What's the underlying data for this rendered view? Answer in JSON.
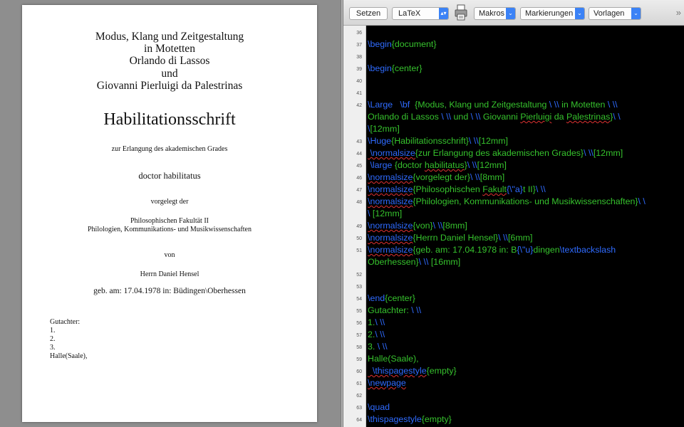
{
  "preview": {
    "header_lines": [
      "Modus, Klang und Zeitgestaltung",
      "in Motetten",
      "Orlando di Lassos",
      "und",
      "Giovanni Pierluigi da Palestrinas"
    ],
    "huge_title": "Habilitationsschrift",
    "erlangung": "zur Erlangung des akademischen Grades",
    "degree": "doctor habilitatus",
    "vorgelegt": "vorgelegt der",
    "faculty": "Philosophischen Fakultät II",
    "departments": "Philologien, Kommunikations- und Musikwissenschaften",
    "von": "von",
    "author": "Herrn Daniel Hensel",
    "born": "geb. am: 17.04.1978 in: Büdingen\\Oberhessen",
    "gutachter": "Gutachter:",
    "g1": "1.",
    "g2": "2.",
    "g3": "3.",
    "place": "Halle(Saale),"
  },
  "toolbar": {
    "setzen": "Setzen",
    "format": "LaTeX",
    "makros": "Makros",
    "markierungen": "Markierungen",
    "vorlagen": "Vorlagen",
    "arrow": "⌄",
    "more": "»",
    "icons": {
      "print": "printer-icon",
      "more": "chevron-double-right-icon"
    }
  },
  "editor": {
    "line_numbers": [
      "36",
      "37",
      "38",
      "39",
      "40",
      "41",
      "42",
      "43",
      "44",
      "45",
      "46",
      "47",
      "48",
      "49",
      "50",
      "51",
      "52",
      "53",
      "54",
      "55",
      "56",
      "57",
      "58",
      "59",
      "60",
      "61",
      "62",
      "63",
      "64"
    ],
    "code": {
      "l37a": "\\begin",
      "l37b": "{document}",
      "l39a": "\\begin",
      "l39b": "{center}",
      "l42a": "\\Large   \\bf",
      "l42b": "  {Modus, Klang und Zeitgestaltung ",
      "l42c": "\\ \\\\",
      "l42d": " in Motetten ",
      "l42e": "\\ \\\\",
      "l42f": "Orlando di Lassos ",
      "l42g": "\\ \\\\",
      "l42h": " und ",
      "l42i": "\\ \\\\",
      "l42j": " Giovanni ",
      "l42k": "Pierluigi",
      "l42l": " da ",
      "l42m": "Palestrinas",
      "l42n": "}",
      "l42o": "\\ \\",
      "l42p": "\\",
      "l42q": "[12mm]",
      "l43a": "\\Huge",
      "l43b": "{Habilitationsschrift}",
      "l43c": "\\ \\\\",
      "l43d": "[12mm]",
      "l44a": " \\normalsize",
      "l44b": "{zur Erlangung des akademischen Grades}",
      "l44c": "\\ \\\\",
      "l44d": "[12mm]",
      "l45a": " \\large",
      "l45b": " {doctor ",
      "l45c": "habilitatus",
      "l45d": "}",
      "l45e": "\\ \\\\",
      "l45f": "[12mm]",
      "l46a": "\\normalsize",
      "l46b": "{vorgelegt der}",
      "l46c": "\\ \\\\",
      "l46d": "[8mm]",
      "l47a": "\\normalsize",
      "l47b": "{Philosophischen ",
      "l47c": "Fakult",
      "l47d": "{\\\"a}",
      "l47e": "t II}",
      "l47f": "\\ \\\\",
      "l48a": "\\normalsize",
      "l48b": "{Philologien, Kommunikations- und Musikwissenschaften}",
      "l48c": "\\ \\",
      "l48d": "\\",
      "l48e": " [12mm]",
      "l49a": "\\normalsize",
      "l49b": "{von}",
      "l49c": "\\ \\\\",
      "l49d": "[8mm]",
      "l50a": "\\normalsize",
      "l50b": "{Herrn Daniel Hensel}",
      "l50c": "\\ \\\\",
      "l50d": "[6mm]",
      "l51a": "\\normalsize",
      "l51b": "{geb. am: 17.04.1978 in: B",
      "l51c": "{\\\"u}",
      "l51d": "dingen",
      "l51e": "\\textbackslash",
      "l51f": "Oberhessen}",
      "l51g": "\\ \\\\",
      "l51h": " [16mm]",
      "l54a": "\\end",
      "l54b": "{center}",
      "l55a": "Gutachter: ",
      "l55b": "\\ \\\\",
      "l56a": "1.",
      "l56b": "\\ \\\\",
      "l57a": "2.",
      "l57b": "\\ \\\\",
      "l58a": "3. ",
      "l58b": "\\ \\\\",
      "l59": "Halle(Saale),",
      "l60a": "  \\thispagestyle",
      "l60b": "{empty}",
      "l61": "\\newpage",
      "l63": "\\quad",
      "l64a": "\\thispagestyle",
      "l64b": "{empty}"
    }
  }
}
